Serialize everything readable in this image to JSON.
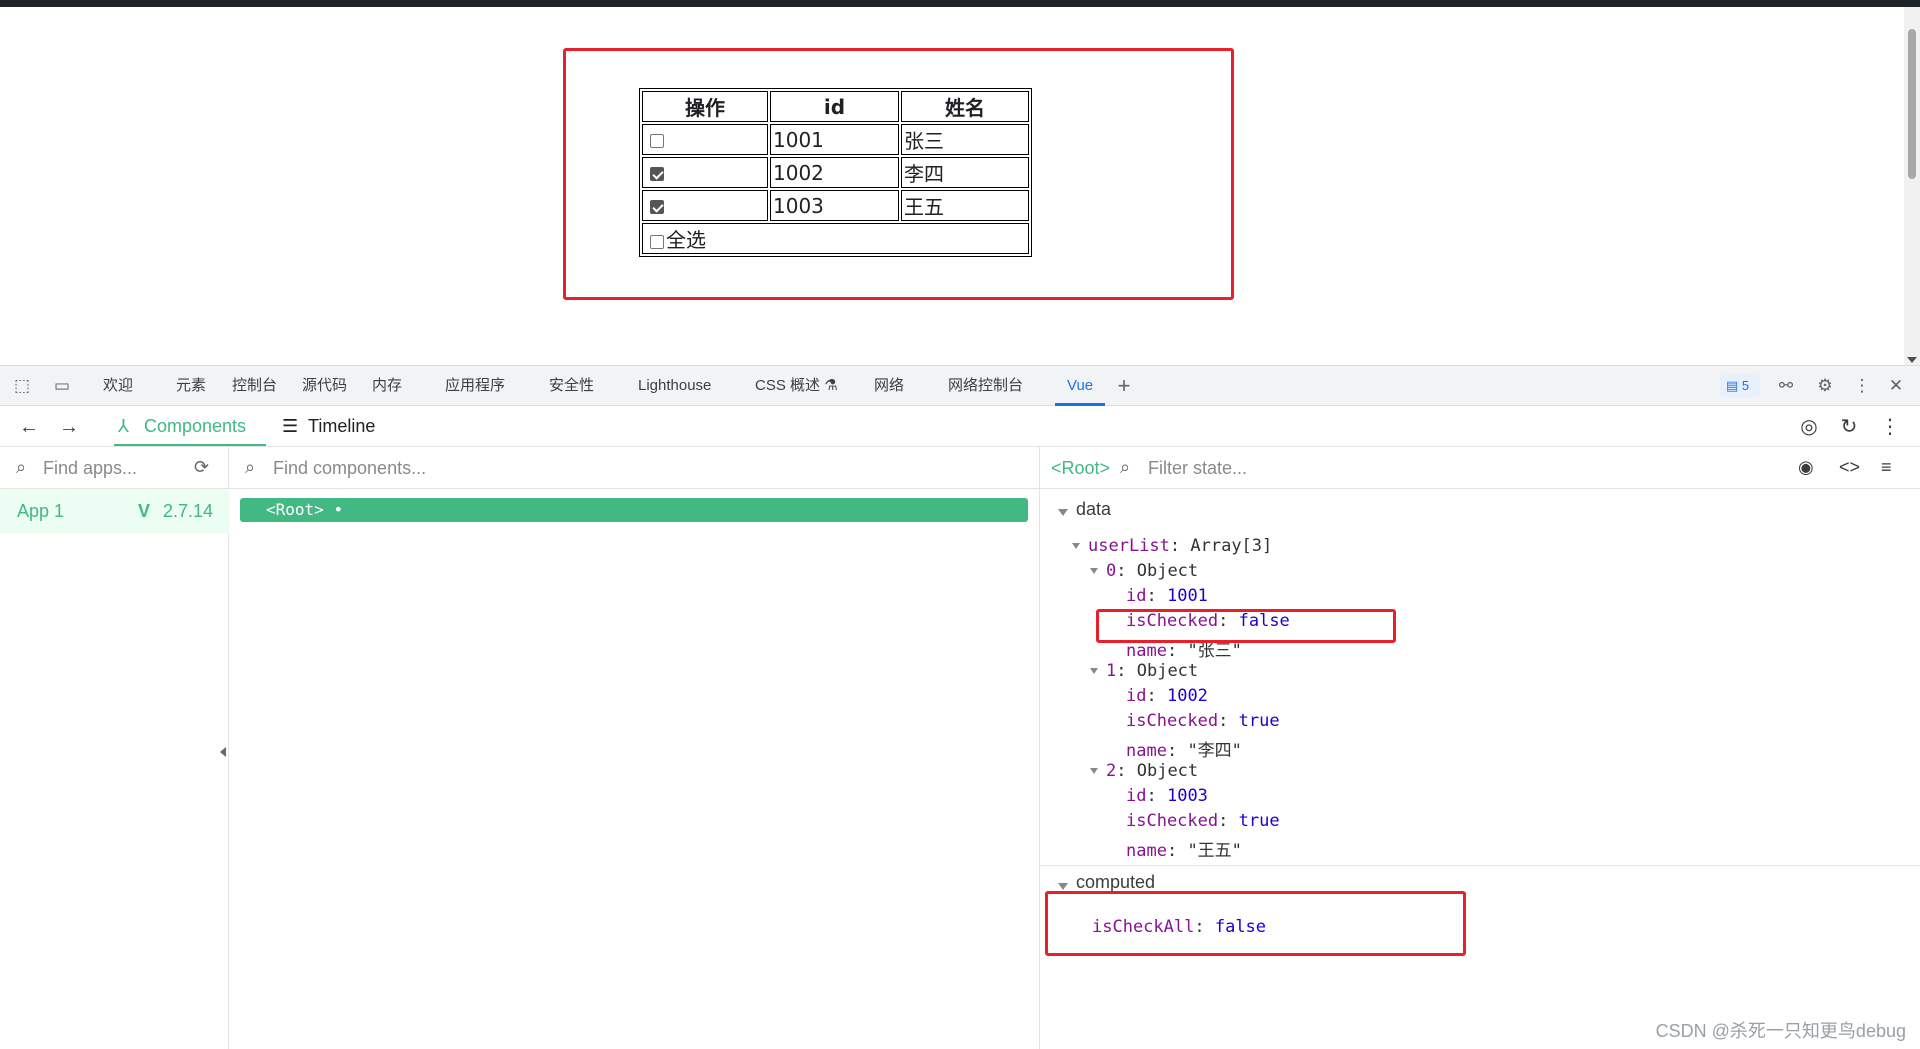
{
  "page": {
    "table": {
      "headers": [
        "操作",
        "id",
        "姓名"
      ],
      "rows": [
        {
          "checked": false,
          "id": "1001",
          "name": "张三"
        },
        {
          "checked": true,
          "id": "1002",
          "name": "李四"
        },
        {
          "checked": true,
          "id": "1003",
          "name": "王五"
        }
      ],
      "select_all_label": "全选",
      "select_all_checked": false
    }
  },
  "devtools": {
    "tabs": [
      "欢迎",
      "元素",
      "控制台",
      "源代码",
      "内存",
      "应用程序",
      "安全性",
      "Lighthouse",
      "CSS 概述",
      "网络",
      "网络控制台",
      "Vue"
    ],
    "active_tab": "Vue",
    "issues_count": "5",
    "vue": {
      "tabs": [
        "Components",
        "Timeline"
      ],
      "active_tab": "Components",
      "apps_placeholder": "Find apps...",
      "components_placeholder": "Find components...",
      "app_name": "App 1",
      "vue_version": "2.7.14",
      "root_node": "<Root>",
      "state_root": "<Root>",
      "state_placeholder": "Filter state...",
      "sections": {
        "data_title": "data",
        "computed_title": "computed"
      },
      "data": {
        "userList_key": "userList",
        "userList_type": "Array[3]",
        "items": [
          {
            "index": "0",
            "type": "Object",
            "id": "1001",
            "isChecked": "false",
            "name": "\"张三\""
          },
          {
            "index": "1",
            "type": "Object",
            "id": "1002",
            "isChecked": "true",
            "name": "\"李四\""
          },
          {
            "index": "2",
            "type": "Object",
            "id": "1003",
            "isChecked": "true",
            "name": "\"王五\""
          }
        ]
      },
      "computed": {
        "key": "isCheckAll",
        "value": "false"
      }
    }
  },
  "watermark": "CSDN @杀死一只知更鸟debug",
  "colors": {
    "highlight": "#e8202a",
    "vue_green": "#42b883",
    "devtools_blue": "#1a73e8"
  }
}
